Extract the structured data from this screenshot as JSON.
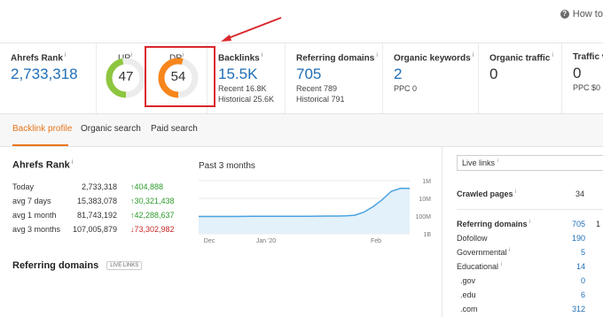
{
  "help": {
    "label": "How to"
  },
  "metrics": {
    "ahrefs_rank": {
      "label": "Ahrefs Rank",
      "value": "2,733,318"
    },
    "ur": {
      "label": "UR",
      "value": "47",
      "level": 47,
      "color": "#8dc63f"
    },
    "dr": {
      "label": "DR",
      "value": "54",
      "level": 54,
      "color": "#f7861c"
    },
    "backlinks": {
      "label": "Backlinks",
      "value": "15.5K",
      "recent": "Recent 16.8K",
      "historical": "Historical 25.6K"
    },
    "referring_domains": {
      "label": "Referring domains",
      "value": "705",
      "recent": "Recent 789",
      "historical": "Historical 791"
    },
    "organic_keywords": {
      "label": "Organic keywords",
      "value": "2",
      "ppc": "PPC 0"
    },
    "organic_traffic": {
      "label": "Organic traffic",
      "value": "0"
    },
    "traffic_value": {
      "label": "Traffic va",
      "value": "0",
      "ppc": "PPC $0"
    }
  },
  "tabs": [
    {
      "label": "Backlink profile",
      "active": true
    },
    {
      "label": "Organic search",
      "active": false
    },
    {
      "label": "Paid search",
      "active": false
    }
  ],
  "rank_section": {
    "title": "Ahrefs Rank",
    "rows": [
      {
        "period": "Today",
        "value": "2,733,318",
        "change": "↑404,888",
        "dir": "up"
      },
      {
        "period": "avg 7 days",
        "value": "15,383,078",
        "change": "↑30,321,438",
        "dir": "up"
      },
      {
        "period": "avg 1 month",
        "value": "81,743,192",
        "change": "↑42,288,637",
        "dir": "up"
      },
      {
        "period": "avg 3 months",
        "value": "107,005,879",
        "change": "↓73,302,982",
        "dir": "down"
      }
    ]
  },
  "chart_data": {
    "type": "area",
    "title": "Past 3 months",
    "x_labels": [
      "Dec",
      "Jan '20",
      "Feb"
    ],
    "y_labels": [
      "1M",
      "10M",
      "100M",
      "1B"
    ],
    "y_scale": "log-reversed",
    "series": [
      {
        "values": [
          106000000,
          106000000,
          106000000,
          106000000,
          106000000,
          105000000,
          104000000,
          104000000,
          104000000,
          103000000,
          103000000,
          102000000,
          102000000,
          101000000,
          100000000,
          100000000,
          98000000,
          90000000,
          60000000,
          30000000,
          12000000,
          4000000,
          2700000,
          2733318
        ]
      }
    ],
    "color": "#4aa3df"
  },
  "referring_section": {
    "title": "Referring domains",
    "badge": "LIVE LINKS"
  },
  "right_panel": {
    "select_value": "Live links",
    "crawled_pages": {
      "label": "Crawled pages",
      "value": "34"
    },
    "referring_domains": {
      "label": "Referring domains",
      "value": "705",
      "extra": "1"
    },
    "rows": [
      {
        "label": "Dofollow",
        "value": "190",
        "info": false
      },
      {
        "label": "Governmental",
        "value": "5",
        "info": true
      },
      {
        "label": "Educational",
        "value": "14",
        "info": true
      },
      {
        "label": ".gov",
        "value": "0",
        "info": false
      },
      {
        "label": ".edu",
        "value": "6",
        "info": false
      },
      {
        "label": ".com",
        "value": "312",
        "info": false
      }
    ]
  }
}
